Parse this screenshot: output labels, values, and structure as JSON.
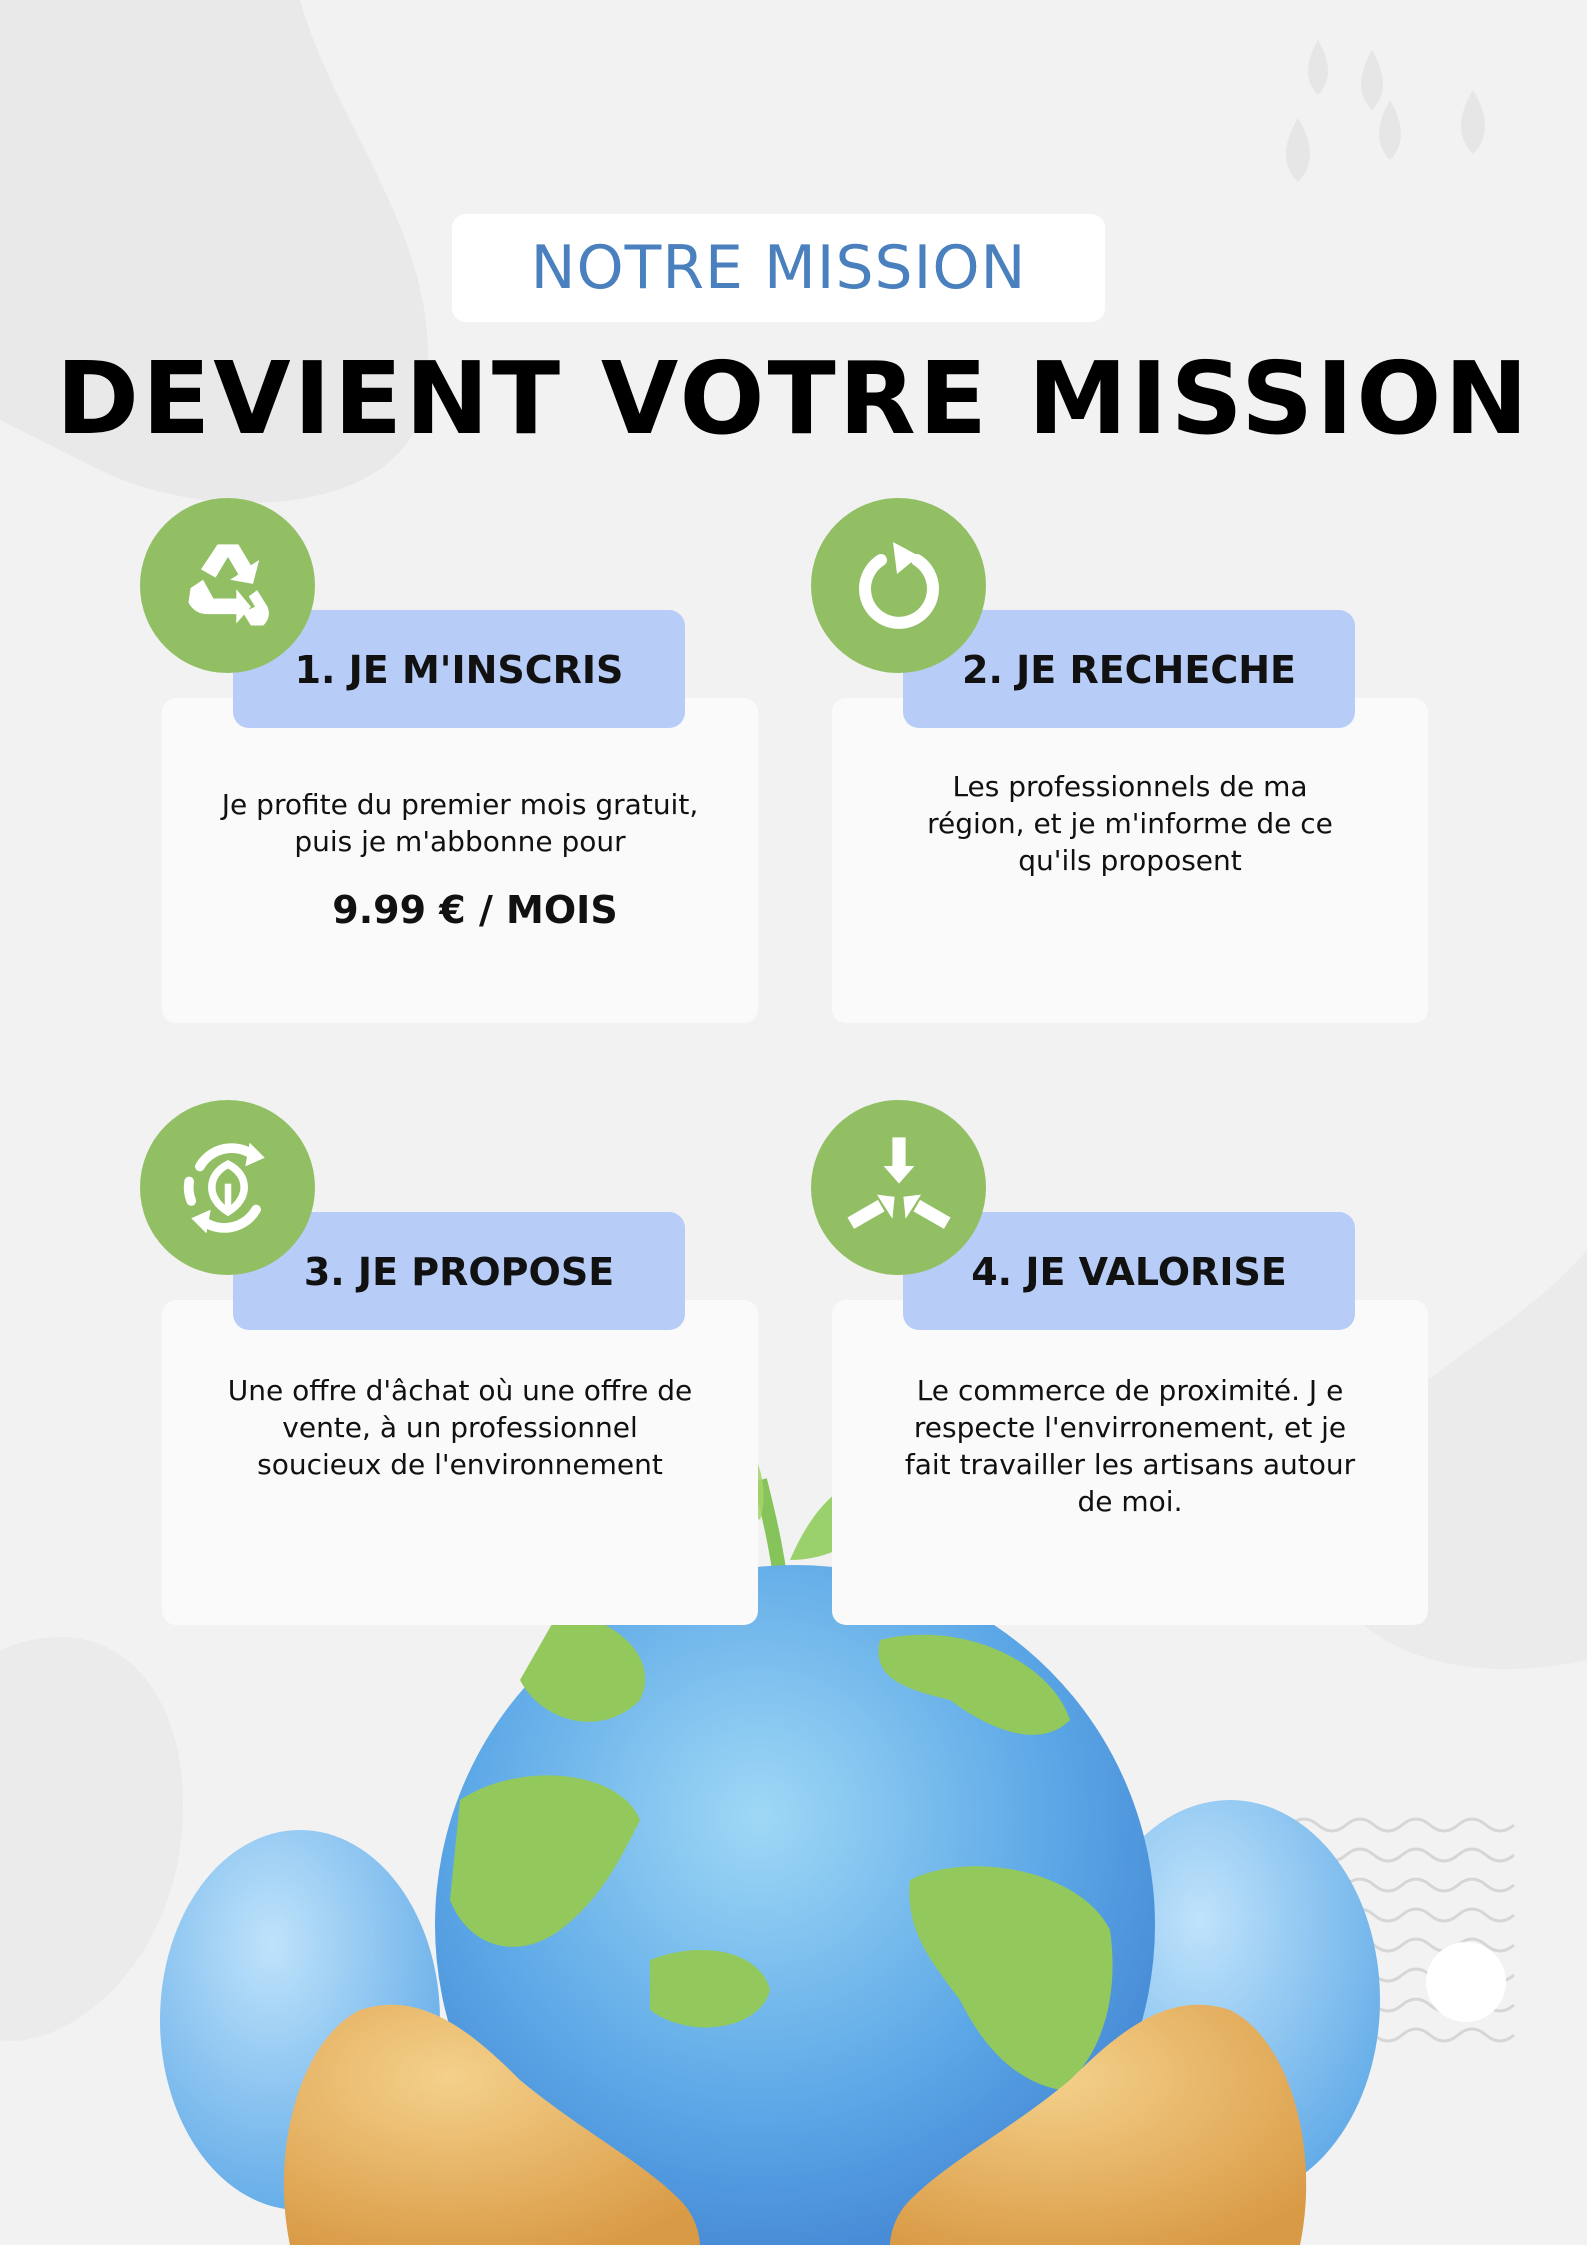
{
  "header": {
    "kicker": "NOTRE MISSION",
    "title": "DEVIENT VOTRE MISSION"
  },
  "colors": {
    "accent_green": "#92bf64",
    "tab_blue": "#b7cdf8",
    "kicker_blue": "#4a80bd",
    "background": "#f2f2f2"
  },
  "steps": [
    {
      "label": "1. JE M'INSCRIS",
      "icon": "recycle-icon",
      "lines": [
        "Je profite du premier mois gratuit,",
        "puis je m'abbonne pour"
      ],
      "price": "9.99 € / MOIS"
    },
    {
      "label": "2. JE RECHECHE",
      "icon": "refresh-arrow-icon",
      "lines": [
        "Les professionnels de ma",
        "région, et je m'informe de ce",
        "qu'ils proposent"
      ]
    },
    {
      "label": "3. JE PROPOSE",
      "icon": "eco-cycle-leaf-icon",
      "lines": [
        "Une offre d'âchat où une offre de",
        "vente, à un professionnel",
        "soucieux de l'environnement"
      ]
    },
    {
      "label": "4. JE VALORISE",
      "icon": "converging-arrows-icon",
      "lines": [
        "Le commerce de proximité. J e",
        "respecte l'envirronement, et je",
        "fait travailler les artisans autour",
        "de moi."
      ]
    }
  ]
}
